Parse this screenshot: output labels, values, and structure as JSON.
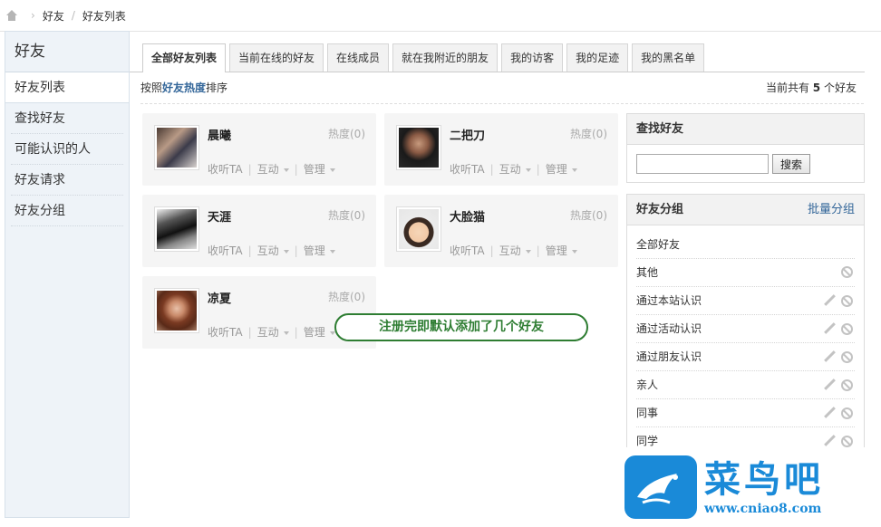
{
  "breadcrumb": {
    "items": [
      "好友",
      "好友列表"
    ]
  },
  "sidebar": {
    "title": "好友",
    "items": [
      {
        "label": "好友列表",
        "active": true
      },
      {
        "label": "查找好友"
      },
      {
        "label": "可能认识的人"
      },
      {
        "label": "好友请求"
      },
      {
        "label": "好友分组"
      }
    ]
  },
  "tabs": [
    "全部好友列表",
    "当前在线的好友",
    "在线成员",
    "就在我附近的朋友",
    "我的访客",
    "我的足迹",
    "我的黑名单"
  ],
  "sort": {
    "prefix": "按照",
    "key": "好友热度",
    "suffix": "排序"
  },
  "count": {
    "prefix": "当前共有",
    "value": "5",
    "suffix": "个好友"
  },
  "friends": [
    {
      "name": "晨曦",
      "hot": "热度(0)",
      "follow": "收听TA",
      "interact": "互动",
      "manage": "管理"
    },
    {
      "name": "二把刀",
      "hot": "热度(0)",
      "follow": "收听TA",
      "interact": "互动",
      "manage": "管理"
    },
    {
      "name": "天涯",
      "hot": "热度(0)",
      "follow": "收听TA",
      "interact": "互动",
      "manage": "管理"
    },
    {
      "name": "大脸猫",
      "hot": "热度(0)",
      "follow": "收听TA",
      "interact": "互动",
      "manage": "管理"
    },
    {
      "name": "凉夏",
      "hot": "热度(0)",
      "follow": "收听TA",
      "interact": "互动",
      "manage": "管理"
    }
  ],
  "search_panel": {
    "title": "查找好友",
    "button": "搜索",
    "input_value": ""
  },
  "group_panel": {
    "title": "好友分组",
    "action": "批量分组",
    "groups": [
      "全部好友",
      "其他",
      "通过本站认识",
      "通过活动认识",
      "通过朋友认识",
      "亲人",
      "同事",
      "同学"
    ]
  },
  "annotation": "注册完即默认添加了几个好友",
  "watermark": {
    "name": "菜鸟吧",
    "url": "www.cniao8.com"
  },
  "colors": {
    "link": "#336699",
    "annotation": "#2e7d32",
    "watermark": "#1a8ad8"
  }
}
